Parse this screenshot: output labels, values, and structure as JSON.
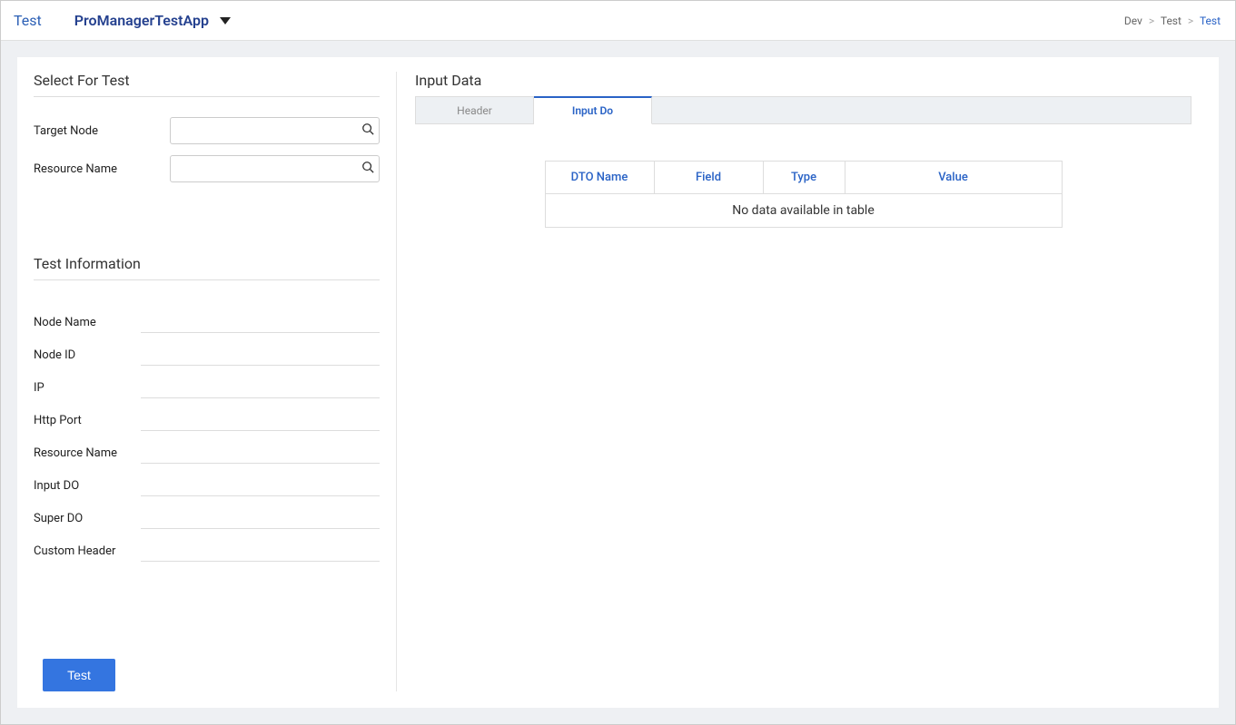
{
  "header": {
    "title": "Test",
    "app_name": "ProManagerTestApp"
  },
  "breadcrumb": {
    "level1": "Dev",
    "level2": "Test",
    "current": "Test"
  },
  "left": {
    "select_title": "Select For Test",
    "target_node_label": "Target Node",
    "resource_name_label": "Resource Name",
    "info_title": "Test Information",
    "info_rows": {
      "node_name": "Node Name",
      "node_id": "Node ID",
      "ip": "IP",
      "http_port": "Http Port",
      "resource_name": "Resource Name",
      "input_do": "Input DO",
      "super_do": "Super DO",
      "custom_header": "Custom Header"
    },
    "test_button": "Test"
  },
  "right": {
    "title": "Input Data",
    "tabs": {
      "header": "Header",
      "input_do": "Input Do"
    },
    "table": {
      "columns": {
        "dto_name": "DTO  Name",
        "field": "Field",
        "type": "Type",
        "value": "Value"
      },
      "empty_message": "No data available in table"
    }
  }
}
